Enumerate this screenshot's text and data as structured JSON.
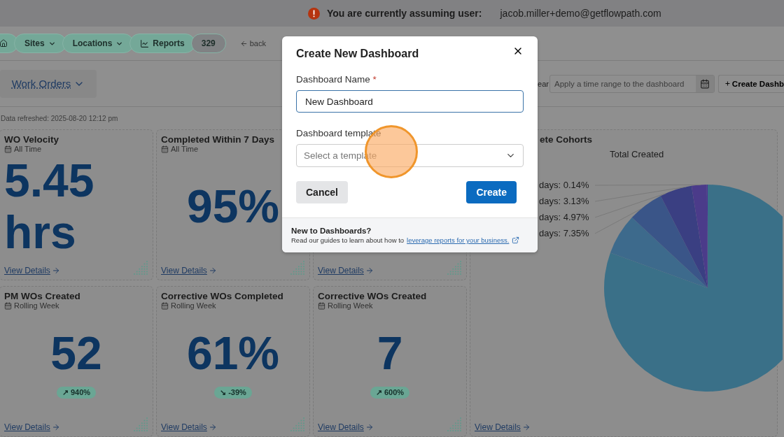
{
  "banner": {
    "label": "You are currently assuming user:",
    "email": "jacob.miller+demo@getflowpath.com"
  },
  "breadcrumbs": [
    {
      "kind": "home"
    },
    {
      "kind": "menu",
      "label": "Sites"
    },
    {
      "kind": "menu",
      "label": "Locations"
    },
    {
      "kind": "report",
      "label": "Reports"
    }
  ],
  "count": "329",
  "back": "back",
  "report_menu": {
    "label": "Work Orders"
  },
  "clear_label": "ear",
  "time_range": {
    "placeholder": "Apply a time range to the dashboard"
  },
  "create_button": "Create Dashb",
  "refreshed": "Data refreshed:  2025-08-20 12:12 pm",
  "cards": [
    {
      "title": "WO Velocity",
      "period": "All Time",
      "value": "5.45 hrs",
      "link": "View Details"
    },
    {
      "title": "Completed Within 7 Days",
      "period": "All Time",
      "value": "95%",
      "link": "View Details"
    },
    {
      "link": "View Details"
    },
    {
      "title": "PM WOs Created",
      "period": "Rolling Week",
      "value": "52",
      "change": "↗ 940%",
      "link": "View Details"
    },
    {
      "title": "Corrective WOs Completed",
      "period": "Rolling Week",
      "value": "61%",
      "change": "↘ -39%",
      "link": "View Details"
    },
    {
      "title": "Corrective WOs Created",
      "period": "Rolling Week",
      "value": "7",
      "change": "↗ 600%",
      "link": "View Details"
    }
  ],
  "cohort_card": {
    "title": "ete Cohorts",
    "chart_title": "Total Created",
    "labels": [
      "days: 0.14%",
      "days: 3.13%",
      "days: 4.97%",
      "days: 7.35%"
    ],
    "link": "View Details"
  },
  "dialog": {
    "title": "Create New Dashboard",
    "fields": [
      {
        "kind": "text",
        "label": "Dashboard Name",
        "required_mark": "*",
        "value": "New Dashboard",
        "focused": true
      },
      {
        "kind": "select",
        "label": "Dashboard template",
        "placeholder": "Select a template",
        "focused": false
      }
    ],
    "buttons": [
      {
        "kind": "secondary",
        "label": "Cancel"
      },
      {
        "kind": "primary",
        "label": "Create"
      }
    ],
    "footer": {
      "heading": "New to Dashboards?",
      "text": "Read our guides to learn about how to",
      "link": "leverage reports for your business."
    }
  }
}
